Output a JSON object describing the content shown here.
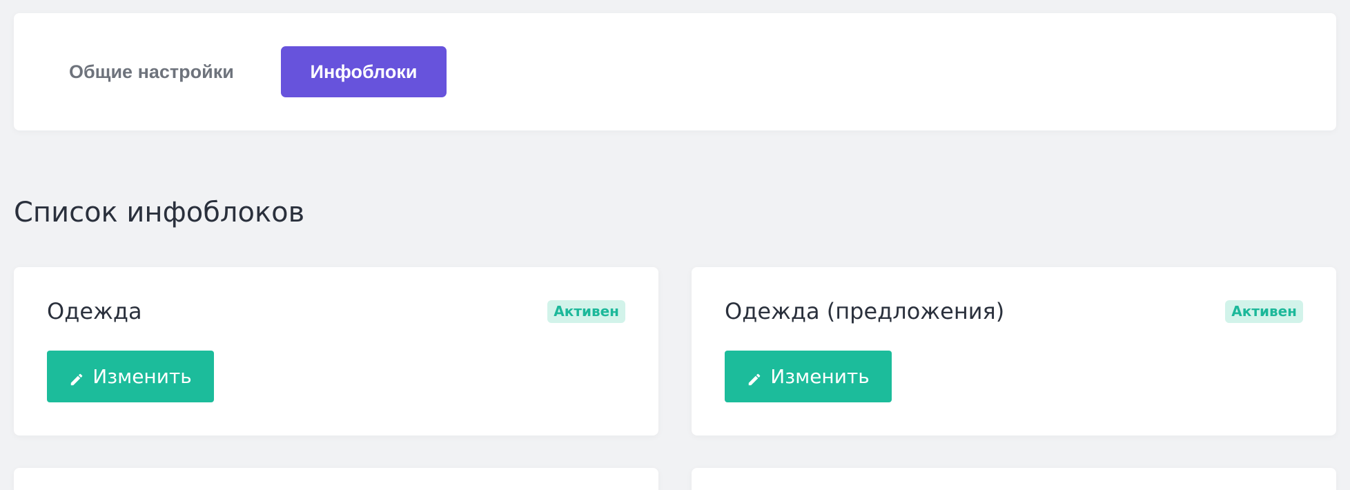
{
  "tabs": [
    {
      "label": "Общие настройки",
      "active": false
    },
    {
      "label": "Инфоблоки",
      "active": true
    }
  ],
  "section": {
    "title": "Список инфоблоков"
  },
  "infoblocks": [
    {
      "name": "Одежда",
      "status": "Активен",
      "edit_label": "Изменить"
    },
    {
      "name": "Одежда (предложения)",
      "status": "Активен",
      "edit_label": "Изменить"
    }
  ],
  "icons": {
    "edit": "pencil-icon"
  },
  "colors": {
    "accent": "#6753dc",
    "success": "#1cbc9b",
    "badge_bg": "#d2f3ea",
    "badge_text": "#1cb89a",
    "page_bg": "#f1f2f4"
  }
}
